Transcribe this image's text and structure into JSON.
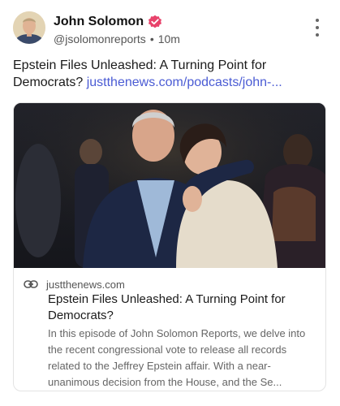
{
  "author": {
    "display_name": "John Solomon",
    "handle": "@jsolomonreports",
    "timestamp": "10m",
    "verified_color": "#e8436b"
  },
  "post": {
    "text": "Epstein Files Unleashed: A Turning Point for Democrats?",
    "link_text": "justthenews.com/podcasts/john-..."
  },
  "link_card": {
    "domain": "justthenews.com",
    "title": "Epstein Files Unleashed: A Turning Point for Democrats?",
    "description": "In this episode of John Solomon Reports, we delve into the recent congressional vote to release all records related to the Jeffrey Epstein affair. With a near-unanimous decision from the House, and the Se...",
    "link_color": "#4a5bd4"
  },
  "icons": {
    "verified": "verified-badge-icon",
    "more": "more-options-icon",
    "link": "link-chain-icon"
  }
}
